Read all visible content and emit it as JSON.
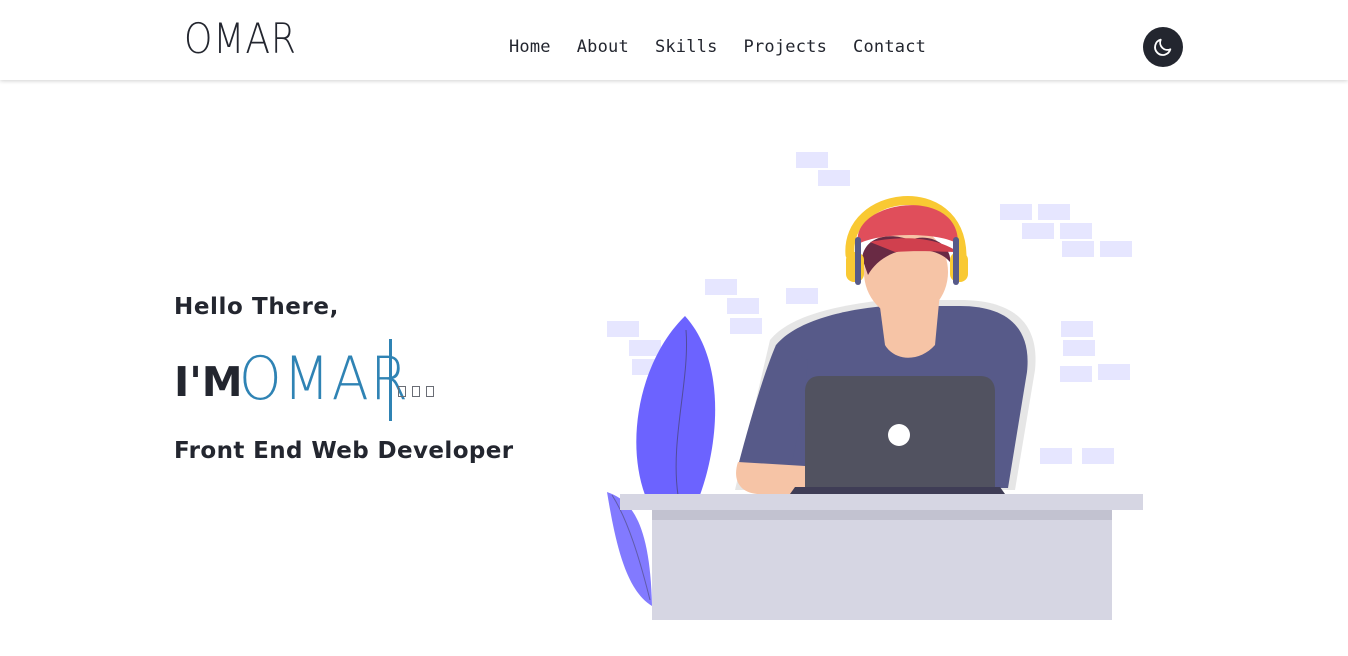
{
  "navbar": {
    "logo": "OMAR",
    "links": [
      "Home",
      "About",
      "Skills",
      "Projects",
      "Contact"
    ],
    "theme_toggle_icon": "moon-icon"
  },
  "hero": {
    "greeting": "Hello There,",
    "prefix": "I'M",
    "name": "OMAR",
    "role": "Front End Web Developer",
    "illustration": "developer-with-laptop-illustration"
  },
  "colors": {
    "text_dark": "#23262f",
    "accent_blue": "#2f83b4",
    "illustration_purple": "#6c63ff",
    "brick_lavender": "#e6e6ff"
  }
}
